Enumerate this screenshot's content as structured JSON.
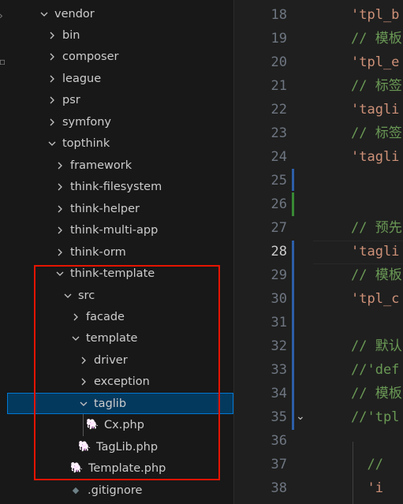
{
  "explorer": {
    "rows": [
      {
        "label": "vendor",
        "chevron": "down",
        "indent": 0
      },
      {
        "label": "bin",
        "chevron": "right",
        "indent": 1
      },
      {
        "label": "composer",
        "chevron": "right",
        "indent": 1
      },
      {
        "label": "league",
        "chevron": "right",
        "indent": 1
      },
      {
        "label": "psr",
        "chevron": "right",
        "indent": 1
      },
      {
        "label": "symfony",
        "chevron": "right",
        "indent": 1
      },
      {
        "label": "topthink",
        "chevron": "down",
        "indent": 1
      },
      {
        "label": "framework",
        "chevron": "right",
        "indent": 2
      },
      {
        "label": "think-filesystem",
        "chevron": "right",
        "indent": 2
      },
      {
        "label": "think-helper",
        "chevron": "right",
        "indent": 2
      },
      {
        "label": "think-multi-app",
        "chevron": "right",
        "indent": 2
      },
      {
        "label": "think-orm",
        "chevron": "right",
        "indent": 2
      },
      {
        "label": "think-template",
        "chevron": "down",
        "indent": 2
      },
      {
        "label": "src",
        "chevron": "down",
        "indent": 3
      },
      {
        "label": "facade",
        "chevron": "right",
        "indent": 4
      },
      {
        "label": "template",
        "chevron": "down",
        "indent": 4
      },
      {
        "label": "driver",
        "chevron": "right",
        "indent": 5
      },
      {
        "label": "exception",
        "chevron": "right",
        "indent": 5
      },
      {
        "label": "taglib",
        "chevron": "down",
        "indent": 5,
        "selected": true
      },
      {
        "label": "Cx.php",
        "icon": "php-elephant-icon",
        "indent": 6
      },
      {
        "label": "TagLib.php",
        "icon": "php-elephant-icon",
        "indent": 5
      },
      {
        "label": "Template.php",
        "icon": "php-elephant-icon",
        "indent": 4
      },
      {
        "label": ".gitignore",
        "icon": "git-icon",
        "indent": 4
      }
    ]
  },
  "editor": {
    "current_line": "28",
    "lines": [
      {
        "num": "18",
        "text": "'tpl_b",
        "kind": "str"
      },
      {
        "num": "19",
        "text": "// 模板",
        "kind": "cmt"
      },
      {
        "num": "20",
        "text": "'tpl_e",
        "kind": "str"
      },
      {
        "num": "21",
        "text": "// 标签",
        "kind": "cmt"
      },
      {
        "num": "22",
        "text": "'tagli",
        "kind": "str"
      },
      {
        "num": "23",
        "text": "// 标签",
        "kind": "cmt"
      },
      {
        "num": "24",
        "text": "'tagli",
        "kind": "str"
      },
      {
        "num": "25",
        "text": "",
        "kind": "str"
      },
      {
        "num": "26",
        "text": "",
        "kind": "str"
      },
      {
        "num": "27",
        "text": "// 预先",
        "kind": "cmt"
      },
      {
        "num": "28",
        "text": "'tagli",
        "kind": "str"
      },
      {
        "num": "29",
        "text": "// 模板",
        "kind": "cmt"
      },
      {
        "num": "30",
        "text": "'tpl_c",
        "kind": "str"
      },
      {
        "num": "31",
        "text": "",
        "kind": "str"
      },
      {
        "num": "32",
        "text": "// 默认",
        "kind": "cmt"
      },
      {
        "num": "33",
        "text": "//'def",
        "kind": "cmt"
      },
      {
        "num": "34",
        "text": "// 模板",
        "kind": "cmt"
      },
      {
        "num": "35",
        "text": "//'tpl",
        "kind": "cmt"
      },
      {
        "num": "36",
        "text": "",
        "kind": "str"
      },
      {
        "num": "37",
        "text": "  //",
        "kind": "cmt"
      },
      {
        "num": "38",
        "text": "  'i",
        "kind": "str"
      }
    ]
  },
  "colors": {
    "highlight_box": "#e51400",
    "selection": "#04395e",
    "php_icon": "#a074c4",
    "string": "#ce9178",
    "comment": "#6a9955",
    "modified_gutter": "#388a34",
    "changed_gutter": "#2c5ea8"
  }
}
